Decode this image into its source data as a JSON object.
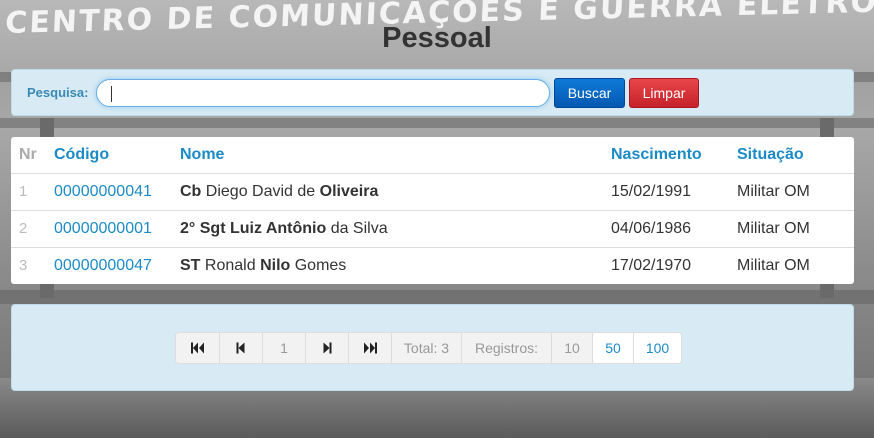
{
  "background": {
    "lettering": "CENTRO DE COMUNICAÇÕES E GUERRA ELETRÔNICA DO"
  },
  "page": {
    "title": "Pessoal"
  },
  "search": {
    "label": "Pesquisa:",
    "value": "",
    "buscar_label": "Buscar",
    "limpar_label": "Limpar"
  },
  "table": {
    "headers": {
      "nr": "Nr",
      "codigo": "Código",
      "nome": "Nome",
      "nascimento": "Nascimento",
      "situacao": "Situação"
    },
    "rows": [
      {
        "nr": "1",
        "codigo": "00000000041",
        "posto": "Cb",
        "nome_a": "Diego David de",
        "nome_guerra": "Oliveira",
        "nome_b": "",
        "nascimento": "15/02/1991",
        "situacao": "Militar OM"
      },
      {
        "nr": "2",
        "codigo": "00000000001",
        "posto": "2° Sgt",
        "nome_a": "",
        "nome_guerra": "Luiz Antônio",
        "nome_b": "da Silva",
        "nascimento": "04/06/1986",
        "situacao": "Militar OM"
      },
      {
        "nr": "3",
        "codigo": "00000000047",
        "posto": "ST",
        "nome_a": "Ronald",
        "nome_guerra": "Nilo",
        "nome_b": "Gomes",
        "nascimento": "17/02/1970",
        "situacao": "Militar OM"
      }
    ]
  },
  "pager": {
    "page": "1",
    "total": "Total: 3",
    "registros_label": "Registros:",
    "sizes": [
      "10",
      "50",
      "100"
    ],
    "icons": [
      "first-page-icon",
      "prev-page-icon",
      "next-page-icon",
      "last-page-icon"
    ]
  },
  "colors": {
    "accent": "#1b8bc6",
    "buscar": "#0a6dc6",
    "limpar": "#d33338",
    "panel": "#d8ebf4"
  }
}
